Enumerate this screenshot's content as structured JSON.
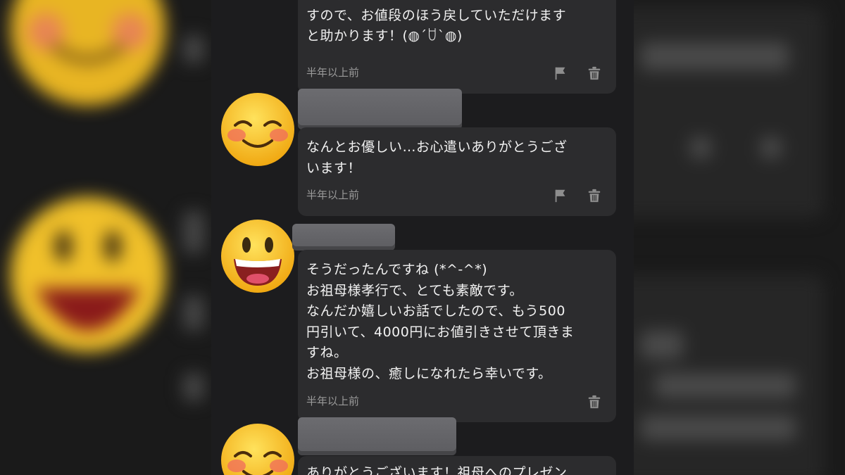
{
  "messages": [
    {
      "text": "今日明日辺り、そろそろ購入可能になりま\nすので、お値段のほう戻していただけます\nと助かります！(◍´ꇴ`◍)",
      "time": "半年以上前",
      "has_flag": true
    },
    {
      "text": "なんとお優しい…お心遣いありがとうござ\nいます！",
      "time": "半年以上前",
      "has_flag": true
    },
    {
      "text": "そうだったんですね (*^-^*)\nお祖母様孝行で、とても素敵です。\nなんだか嬉しいお話でしたので、もう500\n円引いて、4000円にお値引きさせて頂きま\nすね。\nお祖母様の、癒しになれたら幸いです。",
      "time": "半年以上前",
      "has_flag": false
    },
    {
      "text": "ありがとうございます！祖母へのプレゼン",
      "time": "",
      "has_flag": false
    }
  ],
  "icons": {
    "flag": "flag-icon",
    "trash": "trash-icon",
    "avatar_smile": "smiling-face-emoji",
    "avatar_grin": "grinning-face-emoji"
  },
  "colors": {
    "background": "#1c1c1e",
    "bubble": "#2c2c2e",
    "redacted_name": "#66666a",
    "meta_text": "#9a9a9a",
    "emoji_yellow": "#f8c62a"
  }
}
